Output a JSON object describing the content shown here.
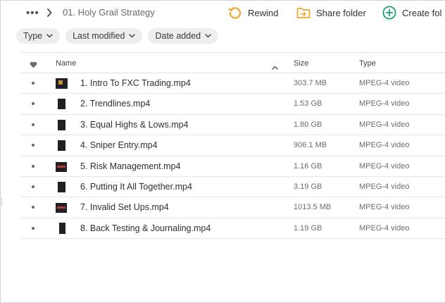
{
  "topbar": {
    "more_label": "•••",
    "breadcrumb": "01. Holy Grail Strategy",
    "actions": {
      "rewind": "Rewind",
      "share": "Share folder",
      "create": "Create fol"
    }
  },
  "filters": [
    {
      "label": "Type"
    },
    {
      "label": "Last modified"
    },
    {
      "label": "Date added"
    }
  ],
  "table": {
    "columns": {
      "name": "Name",
      "size": "Size",
      "type": "Type"
    },
    "rows": [
      {
        "name": "1. Intro To FXC Trading.mp4",
        "size": "303.7 MB",
        "type": "MPEG-4 video"
      },
      {
        "name": "2. Trendlines.mp4",
        "size": "1.53 GB",
        "type": "MPEG-4 video"
      },
      {
        "name": "3. Equal Highs & Lows.mp4",
        "size": "1.80 GB",
        "type": "MPEG-4 video"
      },
      {
        "name": "4. Sniper Entry.mp4",
        "size": "906.1 MB",
        "type": "MPEG-4 video"
      },
      {
        "name": "5. Risk Management.mp4",
        "size": "1.16 GB",
        "type": "MPEG-4 video"
      },
      {
        "name": "6. Putting It All Together.mp4",
        "size": "3.19 GB",
        "type": "MPEG-4 video"
      },
      {
        "name": "7. Invalid Set Ups.mp4",
        "size": "1013.5 MB",
        "type": "MPEG-4 video"
      },
      {
        "name": "8. Back Testing & Journaling.mp4",
        "size": "1.19 GB",
        "type": "MPEG-4 video"
      }
    ]
  },
  "colors": {
    "rewind_accent": "#f5a623",
    "share_accent": "#f5a623",
    "create_accent": "#1aa36f"
  }
}
